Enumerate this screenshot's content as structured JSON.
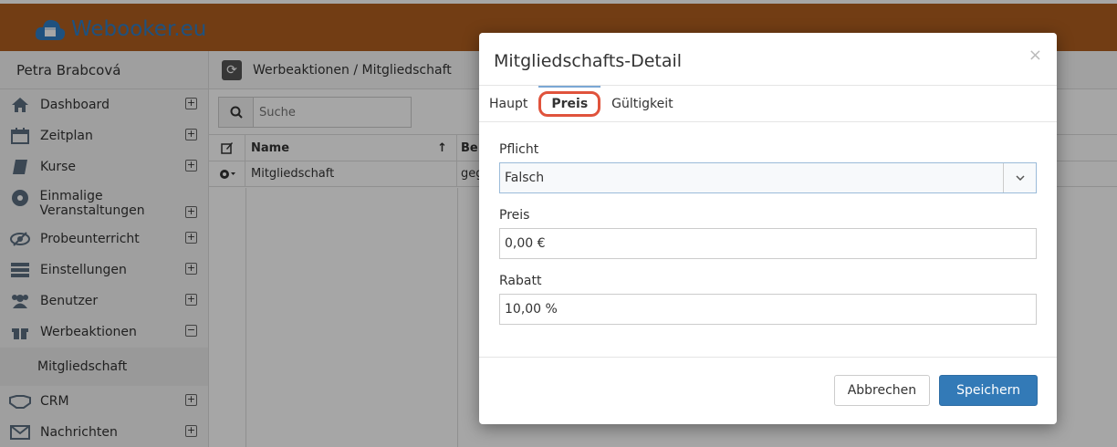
{
  "brand": {
    "name": "Webooker.eu"
  },
  "sidebar": {
    "user": "Petra Brabcová",
    "items": [
      {
        "label": "Dashboard"
      },
      {
        "label": "Zeitplan"
      },
      {
        "label": "Kurse"
      },
      {
        "label": "Einmalige Veranstaltungen"
      },
      {
        "label": "Probeunterricht"
      },
      {
        "label": "Einstellungen"
      },
      {
        "label": "Benutzer"
      },
      {
        "label": "Werbeaktionen"
      },
      {
        "label": "CRM"
      },
      {
        "label": "Nachrichten"
      }
    ],
    "sub_item": "Mitgliedschaft",
    "expand_symbol": "⊞",
    "collapse_symbol": "⊟"
  },
  "main": {
    "breadcrumb": "Werbeaktionen / Mitgliedschaft",
    "search_placeholder": "Suche",
    "columns": {
      "name": "Name",
      "b": "Be"
    },
    "rows": [
      {
        "name": "Mitgliedschaft",
        "b": "geg"
      }
    ]
  },
  "modal": {
    "title": "Mitgliedschafts-Detail",
    "close": "×",
    "tabs": [
      "Haupt",
      "Preis",
      "Gültigkeit"
    ],
    "active_tab": "Preis",
    "fields": {
      "pflicht": {
        "label": "Pflicht",
        "value": "Falsch"
      },
      "preis": {
        "label": "Preis",
        "value": "0,00 €"
      },
      "rabatt": {
        "label": "Rabatt",
        "value": "10,00 %"
      }
    },
    "buttons": {
      "cancel": "Abbrechen",
      "save": "Speichern"
    }
  },
  "colors": {
    "topbar": "#b05f20",
    "brand": "#2f7dc4",
    "primary": "#337ab7",
    "highlight": "#e0533c"
  }
}
